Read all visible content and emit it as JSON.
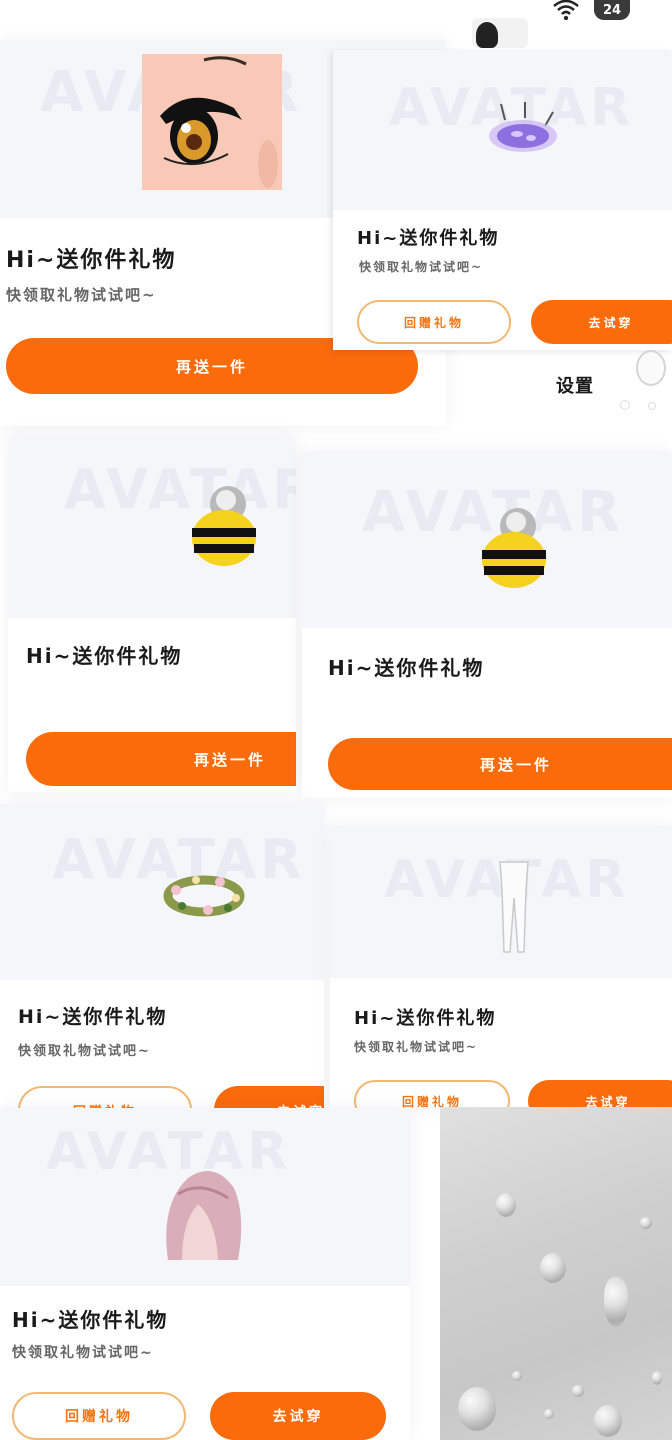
{
  "app": {
    "watermark": "AVATAR"
  },
  "status_bar": {
    "battery": "24"
  },
  "floating": {
    "settings_label": "设置"
  },
  "cards": [
    {
      "title": "Hi~送你件礼物",
      "subtitle": "快领取礼物试试吧~",
      "primary": "再送一件",
      "item": "eye-makeup"
    },
    {
      "title": "Hi~送你件礼物",
      "subtitle": "快领取礼物试试吧~",
      "secondary": "回赠礼物",
      "primary": "去试穿",
      "item": "purple-hair-clip"
    },
    {
      "title": "Hi~送你件礼物",
      "primary": "再送一件",
      "item": "bee-costume"
    },
    {
      "title": "Hi~送你件礼物",
      "primary": "再送一件",
      "item": "bee-costume"
    },
    {
      "title": "Hi~送你件礼物",
      "subtitle": "快领取礼物试试吧~",
      "secondary": "回赠礼物",
      "primary": "去试穿",
      "item": "flower-wreath"
    },
    {
      "title": "Hi~送你件礼物",
      "subtitle": "快领取礼物试试吧~",
      "secondary": "回赠礼物",
      "primary": "去试穿",
      "item": "white-tights"
    },
    {
      "title": "Hi~送你件礼物",
      "subtitle": "快领取礼物试试吧~",
      "secondary": "回赠礼物",
      "primary": "去试穿",
      "item": "pink-hair"
    }
  ],
  "colors": {
    "accent": "#fa6b0c",
    "accent_border": "#f3b873"
  }
}
